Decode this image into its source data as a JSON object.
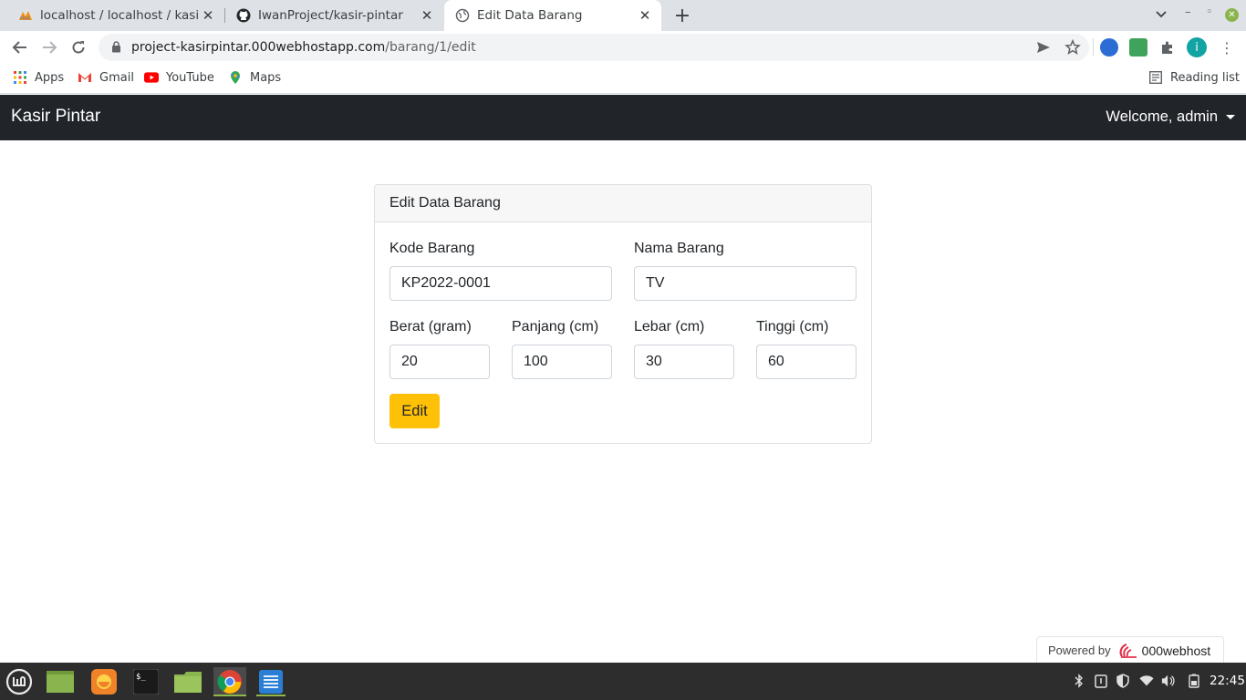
{
  "browser": {
    "tabs": [
      {
        "title": "localhost / localhost / kasirpintar",
        "active": false
      },
      {
        "title": "IwanProject/kasir-pintar",
        "active": false
      },
      {
        "title": "Edit Data Barang",
        "active": true
      }
    ],
    "url_host": "project-kasirpintar.000webhostapp.com",
    "url_path": "/barang/1/edit",
    "bookmarks": [
      "Apps",
      "Gmail",
      "YouTube",
      "Maps"
    ],
    "reading_list": "Reading list",
    "profile_initial": "i"
  },
  "navbar": {
    "brand": "Kasir Pintar",
    "welcome": "Welcome, admin"
  },
  "form": {
    "title": "Edit Data Barang",
    "kode_label": "Kode Barang",
    "kode_value": "KP2022-0001",
    "nama_label": "Nama Barang",
    "nama_value": "TV",
    "berat_label": "Berat (gram)",
    "berat_value": "20",
    "panjang_label": "Panjang (cm)",
    "panjang_value": "100",
    "lebar_label": "Lebar (cm)",
    "lebar_value": "30",
    "tinggi_label": "Tinggi (cm)",
    "tinggi_value": "60",
    "submit_label": "Edit"
  },
  "footer": {
    "powered_by": "Powered by",
    "host_brand": "000webhost"
  },
  "taskbar": {
    "clock": "22:45"
  },
  "colors": {
    "navbar_bg": "#212529",
    "button_warning": "#ffc107"
  }
}
